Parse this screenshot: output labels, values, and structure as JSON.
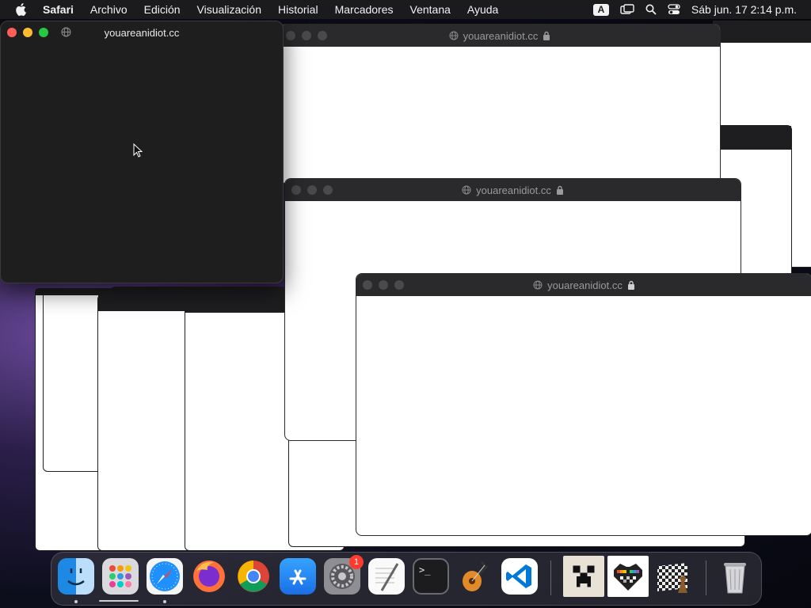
{
  "menubar": {
    "app_name": "Safari",
    "items": [
      "Archivo",
      "Edición",
      "Visualización",
      "Historial",
      "Marcadores",
      "Ventana",
      "Ayuda"
    ],
    "input_source": "A",
    "clock": "Sáb jun. 17  2:14 p.m."
  },
  "active_window": {
    "title": "youareanidiot.cc"
  },
  "popup_windows": [
    {
      "url": "youareanidiot.cc"
    },
    {
      "url": "youareanidiot.cc"
    },
    {
      "url": "youareanidiot.cc"
    }
  ],
  "dock": {
    "items": [
      {
        "name": "finder-icon",
        "running": true
      },
      {
        "name": "launchpad-icon",
        "running": true
      },
      {
        "name": "safari-icon",
        "running": true
      },
      {
        "name": "firefox-icon",
        "running": false
      },
      {
        "name": "chrome-icon",
        "running": false
      },
      {
        "name": "app-store-icon",
        "running": false
      },
      {
        "name": "system-preferences-icon",
        "running": false,
        "badge": "1"
      },
      {
        "name": "textedit-icon",
        "running": false
      },
      {
        "name": "terminal-icon",
        "running": false
      },
      {
        "name": "garageband-icon",
        "running": false
      },
      {
        "name": "vscode-icon",
        "running": false
      },
      {
        "name": "minecraft-icon",
        "running": false
      },
      {
        "name": "pixel-heart-icon",
        "running": false
      },
      {
        "name": "chess-icon",
        "running": false
      },
      {
        "name": "trash-icon",
        "running": false
      }
    ]
  }
}
